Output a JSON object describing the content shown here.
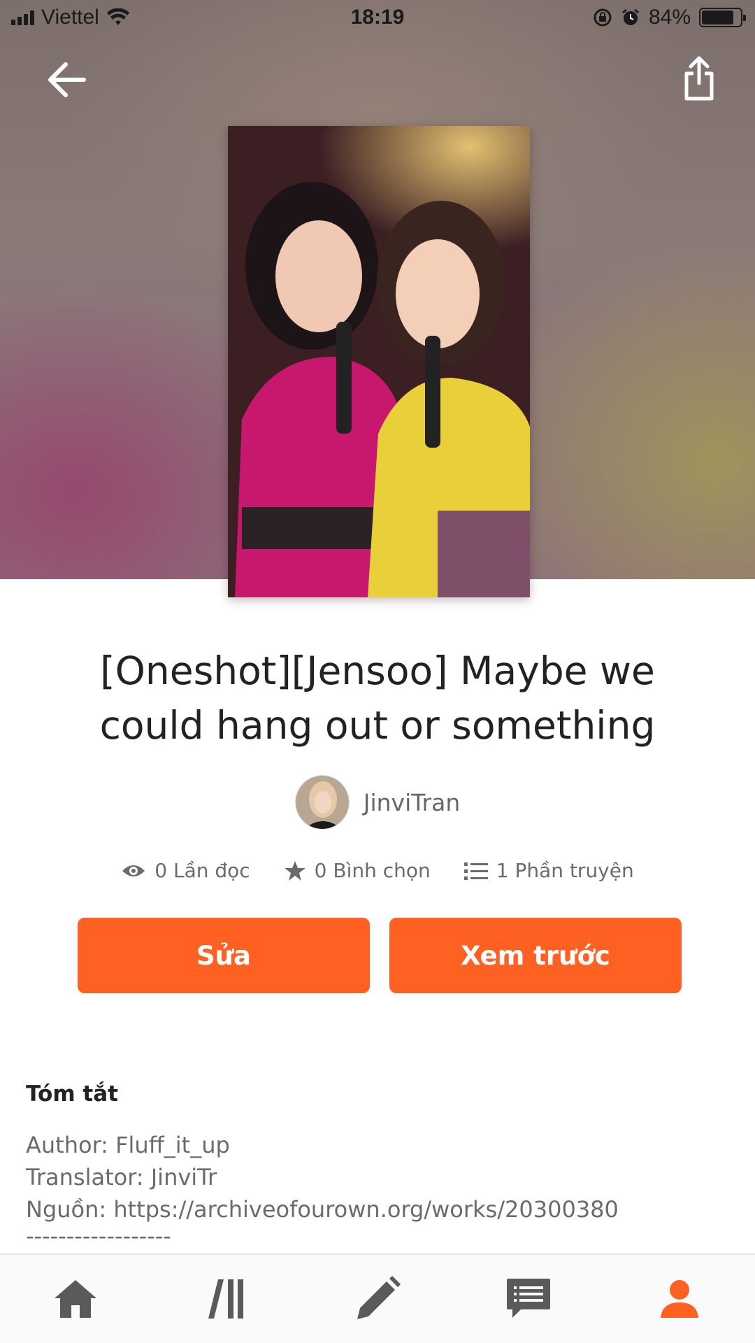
{
  "status_bar": {
    "carrier": "Viettel",
    "time": "18:19",
    "battery_percent": "84%",
    "battery_level": 0.84,
    "icons": [
      "signal-icon",
      "wifi-icon",
      "rotation-lock-icon",
      "alarm-icon",
      "battery-icon"
    ]
  },
  "header": {
    "back_icon": "arrow-left-icon",
    "share_icon": "share-icon"
  },
  "story": {
    "title": "[Oneshot][Jensoo] Maybe we could hang out or something",
    "author": "JinviTran"
  },
  "stats": {
    "reads": "0 Lần đọc",
    "votes": "0 Bình chọn",
    "parts": "1 Phần truyện"
  },
  "actions": {
    "edit_label": "Sửa",
    "preview_label": "Xem trước"
  },
  "summary": {
    "heading": "Tóm tắt",
    "lines": [
      "Author: Fluff_it_up",
      "Translator: JinviTr",
      "Nguồn: https://archiveofourown.org/works/20300380",
      "------------------"
    ]
  },
  "bottom_nav": {
    "items": [
      "home-icon",
      "library-icon",
      "write-icon",
      "messages-icon",
      "profile-icon"
    ],
    "active": "profile-icon"
  },
  "colors": {
    "accent": "#ff6122",
    "text_muted": "#6b6b6b",
    "nav_icon": "#5a5a5a"
  }
}
